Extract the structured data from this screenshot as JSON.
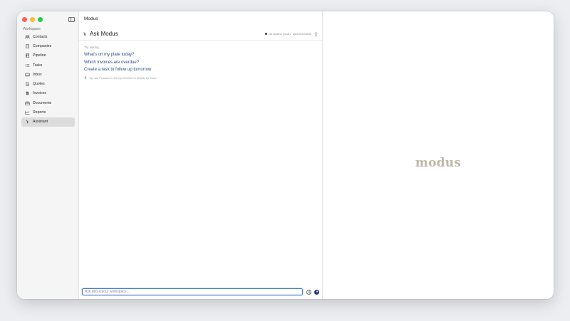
{
  "sidebar": {
    "section_label": "Workspace",
    "items": [
      {
        "label": "Contacts",
        "icon": "contacts-icon"
      },
      {
        "label": "Companies",
        "icon": "companies-icon"
      },
      {
        "label": "Pipeline",
        "icon": "pipeline-icon"
      },
      {
        "label": "Tasks",
        "icon": "tasks-icon"
      },
      {
        "label": "Inbox",
        "icon": "inbox-icon"
      },
      {
        "label": "Quotes",
        "icon": "quotes-icon"
      },
      {
        "label": "Invoices",
        "icon": "invoices-icon"
      },
      {
        "label": "Documents",
        "icon": "documents-icon"
      },
      {
        "label": "Reports",
        "icon": "reports-icon"
      },
      {
        "label": "Assistant",
        "icon": "assistant-icon",
        "active": true
      }
    ]
  },
  "main": {
    "app_title": "Modus",
    "chat_title": "Ask Modus",
    "model_status": "via Ollama (local) · qwen3:8 latest",
    "try_label": "Try asking...",
    "suggestions": [
      "What's on my plate today?",
      "Which invoices are overdue?",
      "Create a task to follow up tomorrow"
    ],
    "tip": "Tip: tap Fn twice in the input below to dictate by voice.",
    "input": {
      "placeholder": "Ask about your workspace...",
      "value": ""
    }
  },
  "preview": {
    "brand": "modus"
  },
  "colors": {
    "accent": "#2f4a8a",
    "send_button": "#1f3a7a",
    "input_focus": "#4a7bd6",
    "brand": "#bfb7a9",
    "active_nav": "#dcdcdc"
  }
}
